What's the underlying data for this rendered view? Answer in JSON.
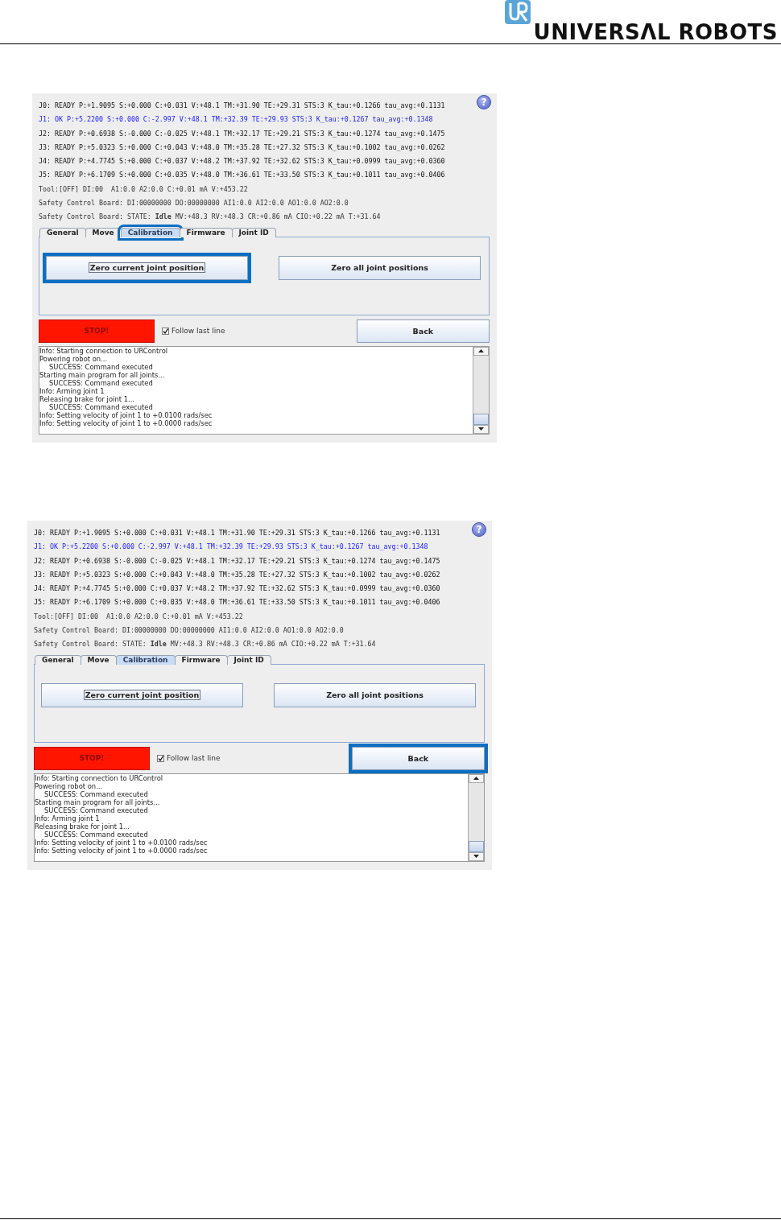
{
  "header": {
    "brand": "UNIVERSΛL ROBOTS"
  },
  "screenshots": [
    {
      "help": "?",
      "status_lines": [
        {
          "text": "J0: READY P:+1.9095 S:+0.000 C:+0.031 V:+48.1 TM:+31.90 TE:+29.31 STS:3 K_tau:+0.1266 tau_avg:+0.1131",
          "highlighted": false
        },
        {
          "text": "J1: OK P:+5.2200 S:+0.000 C:-2.997 V:+48.1 TM:+32.39 TE:+29.93 STS:3 K_tau:+0.1267 tau_avg:+0.1348",
          "highlighted": true
        },
        {
          "text": "J2: READY P:+0.6938 S:-0.000 C:-0.025 V:+48.1 TM:+32.17 TE:+29.21 STS:3 K_tau:+0.1274 tau_avg:+0.1475",
          "highlighted": false
        },
        {
          "text": "J3: READY P:+5.0323 S:+0.000 C:+0.043 V:+48.0 TM:+35.28 TE:+27.32 STS:3 K_tau:+0.1002 tau_avg:+0.0262",
          "highlighted": false
        },
        {
          "text": "J4: READY P:+4.7745 S:+0.000 C:+0.037 V:+48.2 TM:+37.92 TE:+32.62 STS:3 K_tau:+0.0999 tau_avg:+0.0360",
          "highlighted": false
        },
        {
          "text": "J5: READY P:+6.1709 S:+0.000 C:+0.035 V:+48.0 TM:+36.61 TE:+33.50 STS:3 K_tau:+0.1011 tau_avg:+0.0406",
          "highlighted": false
        },
        {
          "text": "Tool:[OFF] DI:00  A1:0.0 A2:0.0 C:+0.01 mA V:+453.22",
          "highlighted": false
        },
        {
          "text": "Safety Control Board: DI:00000000 DO:00000000 AI1:0.0 AI2:0.0 AO1:0.0 AO2:0.0",
          "highlighted": false
        },
        {
          "text": "Safety Control Board: STATE: **Idle** MV:+48.3 RV:+48.3 CR:+0.86 mA CIO:+0.22 mA T:+31.64",
          "highlighted": false
        }
      ],
      "tabs": [
        {
          "label": "General",
          "selected": false,
          "outlined": false
        },
        {
          "label": "Move",
          "selected": false,
          "outlined": false
        },
        {
          "label": "Calibration",
          "selected": true,
          "outlined": true
        },
        {
          "label": "Firmware",
          "selected": false,
          "outlined": false
        },
        {
          "label": "Joint ID",
          "selected": false,
          "outlined": false
        }
      ],
      "buttons": [
        {
          "label": "Zero current joint position",
          "focused": true,
          "outlined": true
        },
        {
          "label": "Zero all joint positions",
          "focused": false,
          "outlined": false
        }
      ],
      "stop": "STOP!",
      "follow": {
        "label": "Follow last line",
        "checked": true
      },
      "back": {
        "label": "Back",
        "outlined": false
      },
      "log": [
        {
          "text": "Info: Starting connection to URControl",
          "indented": false
        },
        {
          "text": "Powering robot on...",
          "indented": false
        },
        {
          "text": "SUCCESS: Command executed",
          "indented": true
        },
        {
          "text": "Starting main program for all joints...",
          "indented": false
        },
        {
          "text": "SUCCESS: Command executed",
          "indented": true
        },
        {
          "text": "Info: Arming joint 1",
          "indented": false
        },
        {
          "text": "Releasing brake for joint 1...",
          "indented": false
        },
        {
          "text": "SUCCESS: Command executed",
          "indented": true
        },
        {
          "text": "Info: Setting velocity of joint 1 to +0.0100 rads/sec",
          "indented": false
        },
        {
          "text": "Info: Setting velocity of joint 1 to +0.0000 rads/sec",
          "indented": false
        }
      ]
    },
    {
      "help": "?",
      "status_lines": [
        {
          "text": "J0: READY P:+1.9095 S:+0.000 C:+0.031 V:+48.1 TM:+31.90 TE:+29.31 STS:3 K_tau:+0.1266 tau_avg:+0.1131",
          "highlighted": false
        },
        {
          "text": "J1: OK P:+5.2200 S:+0.000 C:-2.997 V:+48.1 TM:+32.39 TE:+29.93 STS:3 K_tau:+0.1267 tau_avg:+0.1348",
          "highlighted": true
        },
        {
          "text": "J2: READY P:+0.6938 S:-0.000 C:-0.025 V:+48.1 TM:+32.17 TE:+29.21 STS:3 K_tau:+0.1274 tau_avg:+0.1475",
          "highlighted": false
        },
        {
          "text": "J3: READY P:+5.0323 S:+0.000 C:+0.043 V:+48.0 TM:+35.28 TE:+27.32 STS:3 K_tau:+0.1002 tau_avg:+0.0262",
          "highlighted": false
        },
        {
          "text": "J4: READY P:+4.7745 S:+0.000 C:+0.037 V:+48.2 TM:+37.92 TE:+32.62 STS:3 K_tau:+0.0999 tau_avg:+0.0360",
          "highlighted": false
        },
        {
          "text": "J5: READY P:+6.1709 S:+0.000 C:+0.035 V:+48.0 TM:+36.61 TE:+33.50 STS:3 K_tau:+0.1011 tau_avg:+0.0406",
          "highlighted": false
        },
        {
          "text": "Tool:[OFF] DI:00  A1:0.0 A2:0.0 C:+0.01 mA V:+453.22",
          "highlighted": false
        },
        {
          "text": "Safety Control Board: DI:00000000 DO:00000000 AI1:0.0 AI2:0.0 AO1:0.0 AO2:0.0",
          "highlighted": false
        },
        {
          "text": "Safety Control Board: STATE: **Idle** MV:+48.3 RV:+48.3 CR:+0.86 mA CIO:+0.22 mA T:+31.64",
          "highlighted": false
        }
      ],
      "tabs": [
        {
          "label": "General",
          "selected": false,
          "outlined": false
        },
        {
          "label": "Move",
          "selected": false,
          "outlined": false
        },
        {
          "label": "Calibration",
          "selected": true,
          "outlined": false
        },
        {
          "label": "Firmware",
          "selected": false,
          "outlined": false
        },
        {
          "label": "Joint ID",
          "selected": false,
          "outlined": false
        }
      ],
      "buttons": [
        {
          "label": "Zero current joint position",
          "focused": true,
          "outlined": false
        },
        {
          "label": "Zero all joint positions",
          "focused": false,
          "outlined": false
        }
      ],
      "stop": "STOP!",
      "follow": {
        "label": "Follow last line",
        "checked": true
      },
      "back": {
        "label": "Back",
        "outlined": true
      },
      "log": [
        {
          "text": "Info: Starting connection to URControl",
          "indented": false
        },
        {
          "text": "Powering robot on...",
          "indented": false
        },
        {
          "text": "SUCCESS: Command executed",
          "indented": true
        },
        {
          "text": "Starting main program for all joints...",
          "indented": false
        },
        {
          "text": "SUCCESS: Command executed",
          "indented": true
        },
        {
          "text": "Info: Arming joint 1",
          "indented": false
        },
        {
          "text": "Releasing brake for joint 1...",
          "indented": false
        },
        {
          "text": "SUCCESS: Command executed",
          "indented": true
        },
        {
          "text": "Info: Setting velocity of joint 1 to +0.0100 rads/sec",
          "indented": false
        },
        {
          "text": "Info: Setting velocity of joint 1 to +0.0000 rads/sec",
          "indented": false
        }
      ]
    }
  ]
}
